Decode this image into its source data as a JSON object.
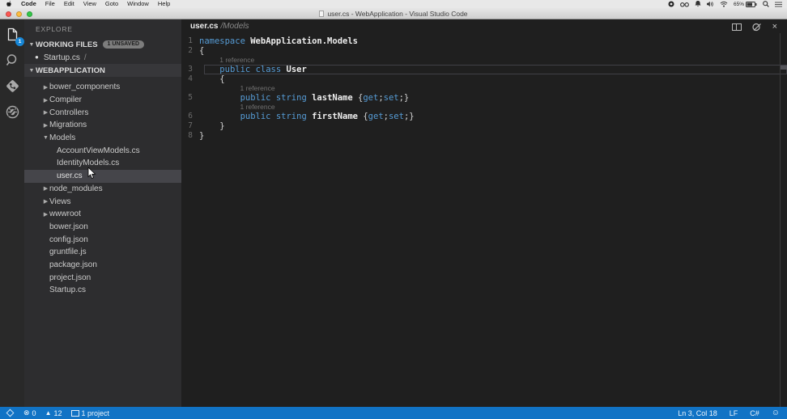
{
  "menu_bar": {
    "items": [
      "Code",
      "File",
      "Edit",
      "View",
      "Goto",
      "Window",
      "Help"
    ],
    "battery": "65%"
  },
  "title_bar": {
    "title": "user.cs - WebApplication - Visual Studio Code"
  },
  "activity_bar": {
    "explorer_badge": "1",
    "items": [
      "explorer",
      "search",
      "git",
      "debug"
    ]
  },
  "sidebar": {
    "title": "EXPLORE",
    "working_files": {
      "label": "WORKING FILES",
      "badge": "1 UNSAVED",
      "item": {
        "name": "Startup.cs",
        "suffix": "/"
      }
    },
    "project": {
      "label": "WEBAPPLICATION",
      "tree": [
        {
          "label": "bower_components",
          "type": "folder",
          "depth": 0,
          "expanded": false
        },
        {
          "label": "Compiler",
          "type": "folder",
          "depth": 0,
          "expanded": false
        },
        {
          "label": "Controllers",
          "type": "folder",
          "depth": 0,
          "expanded": false
        },
        {
          "label": "Migrations",
          "type": "folder",
          "depth": 0,
          "expanded": false
        },
        {
          "label": "Models",
          "type": "folder",
          "depth": 0,
          "expanded": true
        },
        {
          "label": "AccountViewModels.cs",
          "type": "file",
          "depth": 1
        },
        {
          "label": "IdentityModels.cs",
          "type": "file",
          "depth": 1
        },
        {
          "label": "user.cs",
          "type": "file",
          "depth": 1,
          "selected": true
        },
        {
          "label": "node_modules",
          "type": "folder",
          "depth": 0,
          "expanded": false
        },
        {
          "label": "Views",
          "type": "folder",
          "depth": 0,
          "expanded": false
        },
        {
          "label": "wwwroot",
          "type": "folder",
          "depth": 0,
          "expanded": false
        },
        {
          "label": "bower.json",
          "type": "file",
          "depth": 0
        },
        {
          "label": "config.json",
          "type": "file",
          "depth": 0
        },
        {
          "label": "gruntfile.js",
          "type": "file",
          "depth": 0
        },
        {
          "label": "package.json",
          "type": "file",
          "depth": 0
        },
        {
          "label": "project.json",
          "type": "file",
          "depth": 0
        },
        {
          "label": "Startup.cs",
          "type": "file",
          "depth": 0
        }
      ]
    }
  },
  "editor": {
    "tab": {
      "file": "user.cs",
      "path": "/Models"
    },
    "lines": [
      {
        "num": "1",
        "tokens": [
          [
            "kw",
            "namespace"
          ],
          [
            "pl",
            " "
          ],
          [
            "id",
            "WebApplication.Models"
          ]
        ]
      },
      {
        "num": "2",
        "tokens": [
          [
            "pl",
            "{"
          ]
        ]
      },
      {
        "lens": "1 reference",
        "indent": 4
      },
      {
        "num": "3",
        "current": true,
        "tokens": [
          [
            "pl",
            "    "
          ],
          [
            "kw",
            "public"
          ],
          [
            "pl",
            " "
          ],
          [
            "kw",
            "class"
          ],
          [
            "pl",
            " "
          ],
          [
            "id",
            "User"
          ]
        ]
      },
      {
        "num": "4",
        "tokens": [
          [
            "pl",
            "    {"
          ]
        ]
      },
      {
        "lens": "1 reference",
        "indent": 8
      },
      {
        "num": "5",
        "tokens": [
          [
            "pl",
            "        "
          ],
          [
            "kw",
            "public"
          ],
          [
            "pl",
            " "
          ],
          [
            "kw",
            "string"
          ],
          [
            "pl",
            " "
          ],
          [
            "id",
            "lastName"
          ],
          [
            "pl",
            " {"
          ],
          [
            "kw",
            "get"
          ],
          [
            "pl",
            ";"
          ],
          [
            "kw",
            "set"
          ],
          [
            "pl",
            ";}"
          ]
        ]
      },
      {
        "lens": "1 reference",
        "indent": 8
      },
      {
        "num": "6",
        "tokens": [
          [
            "pl",
            "        "
          ],
          [
            "kw",
            "public"
          ],
          [
            "pl",
            " "
          ],
          [
            "kw",
            "string"
          ],
          [
            "pl",
            " "
          ],
          [
            "id",
            "firstName"
          ],
          [
            "pl",
            " {"
          ],
          [
            "kw",
            "get"
          ],
          [
            "pl",
            ";"
          ],
          [
            "kw",
            "set"
          ],
          [
            "pl",
            ";}"
          ]
        ]
      },
      {
        "num": "7",
        "tokens": [
          [
            "pl",
            "    }"
          ]
        ]
      },
      {
        "num": "8",
        "tokens": [
          [
            "pl",
            "}"
          ]
        ]
      }
    ]
  },
  "status_bar": {
    "errors": "0",
    "warnings": "12",
    "project": "1 project",
    "position": "Ln 3, Col 18",
    "eol": "LF",
    "language": "C#"
  },
  "icons": {
    "close": "×",
    "error": "⊗",
    "warning": "▲",
    "feedback": "☺",
    "chevron_collapsed": "▶",
    "chevron_expanded": "▼",
    "dirty": "●",
    "section_arrow": "▼"
  },
  "colors": {
    "accent": "#1173c5",
    "keyword": "#569cd6",
    "badge": "#1786d6",
    "editor_bg": "#1f1f1f",
    "sidebar_bg": "#2d2d2f"
  }
}
